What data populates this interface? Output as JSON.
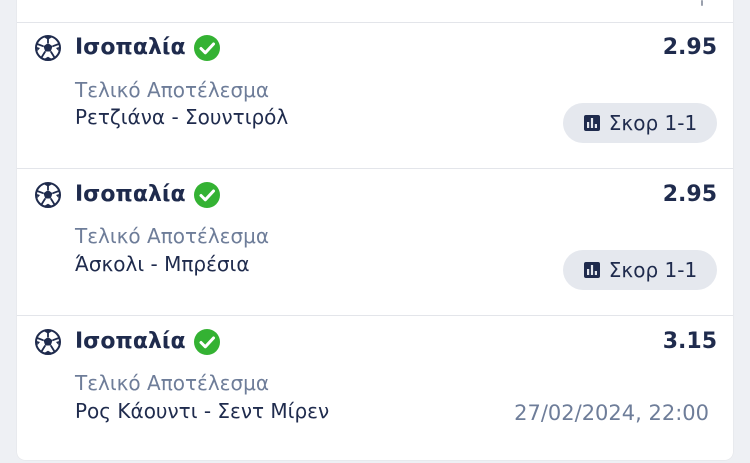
{
  "colors": {
    "text_primary": "#1f2b4d",
    "text_secondary": "#6e7d99",
    "check_green": "#34b233",
    "chip_bg": "#e5e8ee",
    "page_bg": "#eef0f4"
  },
  "bets": [
    {
      "selection": "Ισοπαλία",
      "odds": "2.95",
      "market": "Τελικό Αποτέλεσμα",
      "match": "Ρετζιάνα - Σουντιρόλ",
      "score_chip": "Σκορ 1-1",
      "status_icon": "check-circle-icon",
      "sport_icon": "soccer-ball-icon"
    },
    {
      "selection": "Ισοπαλία",
      "odds": "2.95",
      "market": "Τελικό Αποτέλεσμα",
      "match": "Άσκολι - Μπρέσια",
      "score_chip": "Σκορ 1-1",
      "status_icon": "check-circle-icon",
      "sport_icon": "soccer-ball-icon"
    },
    {
      "selection": "Ισοπαλία",
      "odds": "3.15",
      "market": "Τελικό Αποτέλεσμα",
      "match": "Ρος Κάουντι - Σεντ Μίρεν",
      "datetime": "27/02/2024, 22:00",
      "status_icon": "check-circle-icon",
      "sport_icon": "soccer-ball-icon"
    }
  ]
}
